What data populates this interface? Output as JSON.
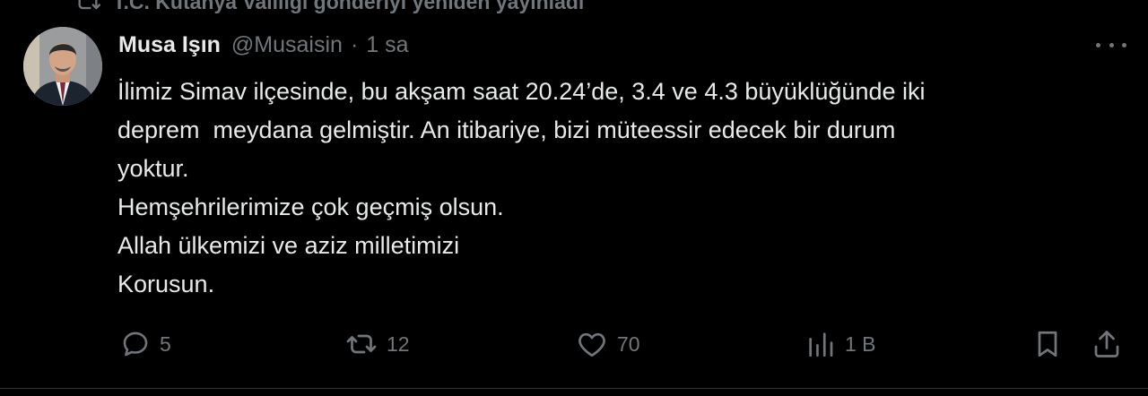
{
  "repost": {
    "text": "T.C. Kütahya Valiliği gönderiyi yeniden yayınladı",
    "icon": "repost-icon"
  },
  "author": {
    "display_name": "Musa Işın",
    "handle": "@Musaisin",
    "separator": "·",
    "time": "1 sa",
    "avatar_icon": "avatar-photo"
  },
  "tweet": {
    "lines": [
      "İlimiz Simav ilçesinde, bu akşam saat 20.24’de, 3.4 ve 4.3 büyüklüğünde iki",
      "deprem  meydana gelmiştir. An itibariye, bizi müteessir edecek bir durum",
      "yoktur.",
      "Hemşehrilerimize çok geçmiş olsun.",
      "Allah ülkemizi ve aziz milletimizi",
      "Korusun."
    ]
  },
  "actions": {
    "reply_count": "5",
    "repost_count": "12",
    "like_count": "70",
    "views_count": "1 B",
    "icons": [
      "reply-icon",
      "repost-icon",
      "like-icon",
      "views-icon",
      "bookmark-icon",
      "share-icon"
    ]
  },
  "colors": {
    "background": "#000000",
    "text": "#e7e9ea",
    "muted": "#71767b"
  }
}
